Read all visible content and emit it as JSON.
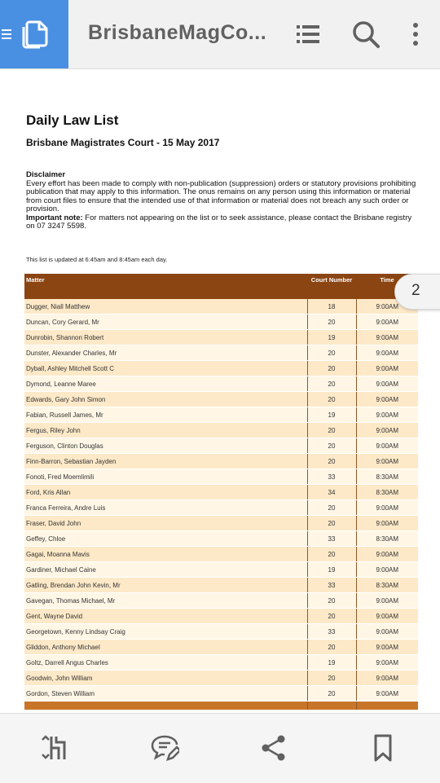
{
  "app": {
    "title": "BrisbaneMagCo...",
    "accent_color": "#4a90e2",
    "icons": [
      "hamburger-menu-icon",
      "document-pages-icon",
      "list-icon",
      "search-icon",
      "more-vert-icon"
    ]
  },
  "document": {
    "title": "Daily Law List",
    "subtitle": "Brisbane Magistrates Court - 15 May 2017",
    "disclaimer_heading": "Disclaimer",
    "disclaimer_text": "Every effort has been made to comply with non-publication (suppression) orders or statutory provisions prohibiting publication that may apply to this information. The onus remains on any person using this information or material from court files to ensure that the intended use of that information or material does not breach any such order or provision.",
    "important_label": "Important note:",
    "important_text": " For matters not appearing on the list or to seek assistance, please contact the Brisbane registry on 07 3247 5598.",
    "update_note": "This list is updated at 6:45am and 8:45am each day.",
    "table": {
      "header_color": "#8b4513",
      "headers": {
        "matter": "Matter",
        "court_number": "Court Number",
        "time": "Time"
      },
      "rows": [
        {
          "matter": "Dugger, Niall Matthew",
          "court": "18",
          "time": "9:00AM"
        },
        {
          "matter": "Duncan, Cory Gerard, Mr",
          "court": "20",
          "time": "9:00AM"
        },
        {
          "matter": "Dunrobin, Shannon Robert",
          "court": "19",
          "time": "9:00AM"
        },
        {
          "matter": "Dunster, Alexander Charles, Mr",
          "court": "20",
          "time": "9:00AM"
        },
        {
          "matter": "Dyball, Ashley Mitchell Scott C",
          "court": "20",
          "time": "9:00AM"
        },
        {
          "matter": "Dymond, Leanne Maree",
          "court": "20",
          "time": "9:00AM"
        },
        {
          "matter": "Edwards, Gary John Simon",
          "court": "20",
          "time": "9:00AM"
        },
        {
          "matter": "Fabian, Russell James, Mr",
          "court": "19",
          "time": "9:00AM"
        },
        {
          "matter": "Fergus, Riley John",
          "court": "20",
          "time": "9:00AM"
        },
        {
          "matter": "Ferguson, Clinton Douglas",
          "court": "20",
          "time": "9:00AM"
        },
        {
          "matter": "Finn-Barron, Sebastian Jayden",
          "court": "20",
          "time": "9:00AM"
        },
        {
          "matter": "Fonoti, Fred Moemlimili",
          "court": "33",
          "time": "8:30AM"
        },
        {
          "matter": "Ford, Kris Allan",
          "court": "34",
          "time": "8:30AM"
        },
        {
          "matter": "Franca Ferreira, Andre Luis",
          "court": "20",
          "time": "9:00AM"
        },
        {
          "matter": "Fraser, David John",
          "court": "20",
          "time": "9:00AM"
        },
        {
          "matter": "Geffey, Chloe",
          "court": "33",
          "time": "8:30AM"
        },
        {
          "matter": "Gagai, Moanna Mavis",
          "court": "20",
          "time": "9:00AM"
        },
        {
          "matter": "Gardiner, Michael Caine",
          "court": "19",
          "time": "9:00AM"
        },
        {
          "matter": "Gatling, Brendan John Kevin, Mr",
          "court": "33",
          "time": "8:30AM"
        },
        {
          "matter": "Gavegan, Thomas Michael, Mr",
          "court": "20",
          "time": "9:00AM"
        },
        {
          "matter": "Gent, Wayne David",
          "court": "20",
          "time": "9:00AM"
        },
        {
          "matter": "Georgetown, Kenny Lindsay Craig",
          "court": "33",
          "time": "9:00AM"
        },
        {
          "matter": "Gliddon, Anthony Michael",
          "court": "20",
          "time": "9:00AM"
        },
        {
          "matter": "Goltz, Darrell Angus Charles",
          "court": "19",
          "time": "9:00AM"
        },
        {
          "matter": "Goodwin, John William",
          "court": "20",
          "time": "9:00AM"
        },
        {
          "matter": "Gordon, Steven William",
          "court": "20",
          "time": "9:00AM"
        }
      ]
    }
  },
  "page_indicator": "2",
  "bottom_toolbar": {
    "icons": [
      "reflow-view-icon",
      "comment-edit-icon",
      "share-icon",
      "bookmark-icon"
    ]
  }
}
